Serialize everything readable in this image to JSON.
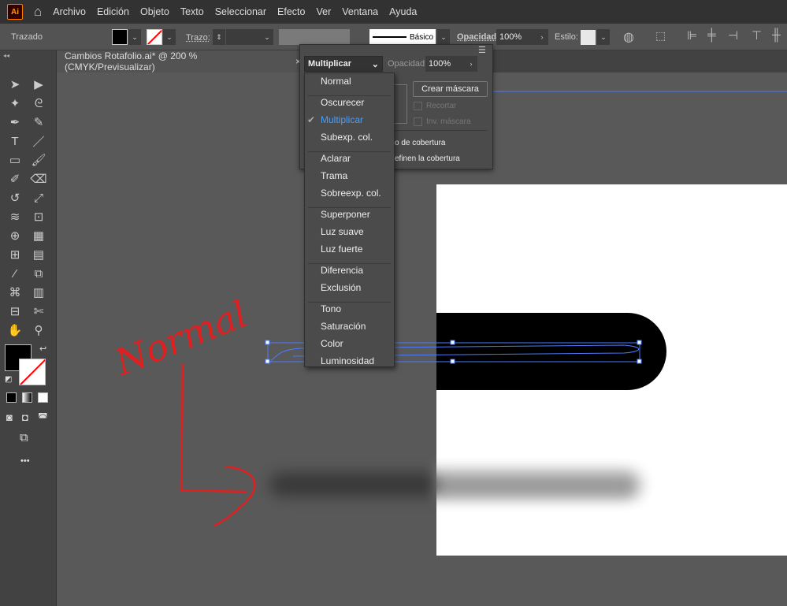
{
  "app": {
    "logo": "Ai",
    "menu": [
      "Archivo",
      "Edición",
      "Objeto",
      "Texto",
      "Seleccionar",
      "Efecto",
      "Ver",
      "Ventana",
      "Ayuda"
    ]
  },
  "control": {
    "selection": "Trazado",
    "stroke_label": "Trazo:",
    "stroke_profile": "Básico",
    "opacity_label": "Opacidad:",
    "opacity": "100%",
    "style_label": "Estilo:"
  },
  "document_tab": {
    "title": "Cambios Rotafolio.ai* @ 200 % (CMYK/Previsualizar)",
    "close": "×"
  },
  "transparency_panel": {
    "blend_mode": "Multiplicar",
    "opacity_label": "Opacidad:",
    "opacity": "100%",
    "make_mask": "Crear máscara",
    "clip": "Recortar",
    "invert_mask": "Inv. máscara",
    "opt1": "o de cobertura",
    "opt2": "efinen la cobertura"
  },
  "blend_menu": {
    "groups": [
      [
        "Normal"
      ],
      [
        "Oscurecer",
        "Multiplicar",
        "Subexp. col."
      ],
      [
        "Aclarar",
        "Trama",
        "Sobreexp. col."
      ],
      [
        "Superponer",
        "Luz suave",
        "Luz fuerte"
      ],
      [
        "Diferencia",
        "Exclusión"
      ],
      [
        "Tono",
        "Saturación",
        "Color",
        "Luminosidad"
      ]
    ],
    "selected": "Multiplicar",
    "selected_color": "#4a9df8"
  },
  "annotation": {
    "text": "Normal",
    "color": "#e02020"
  },
  "toolbar": {
    "more": "•••"
  }
}
